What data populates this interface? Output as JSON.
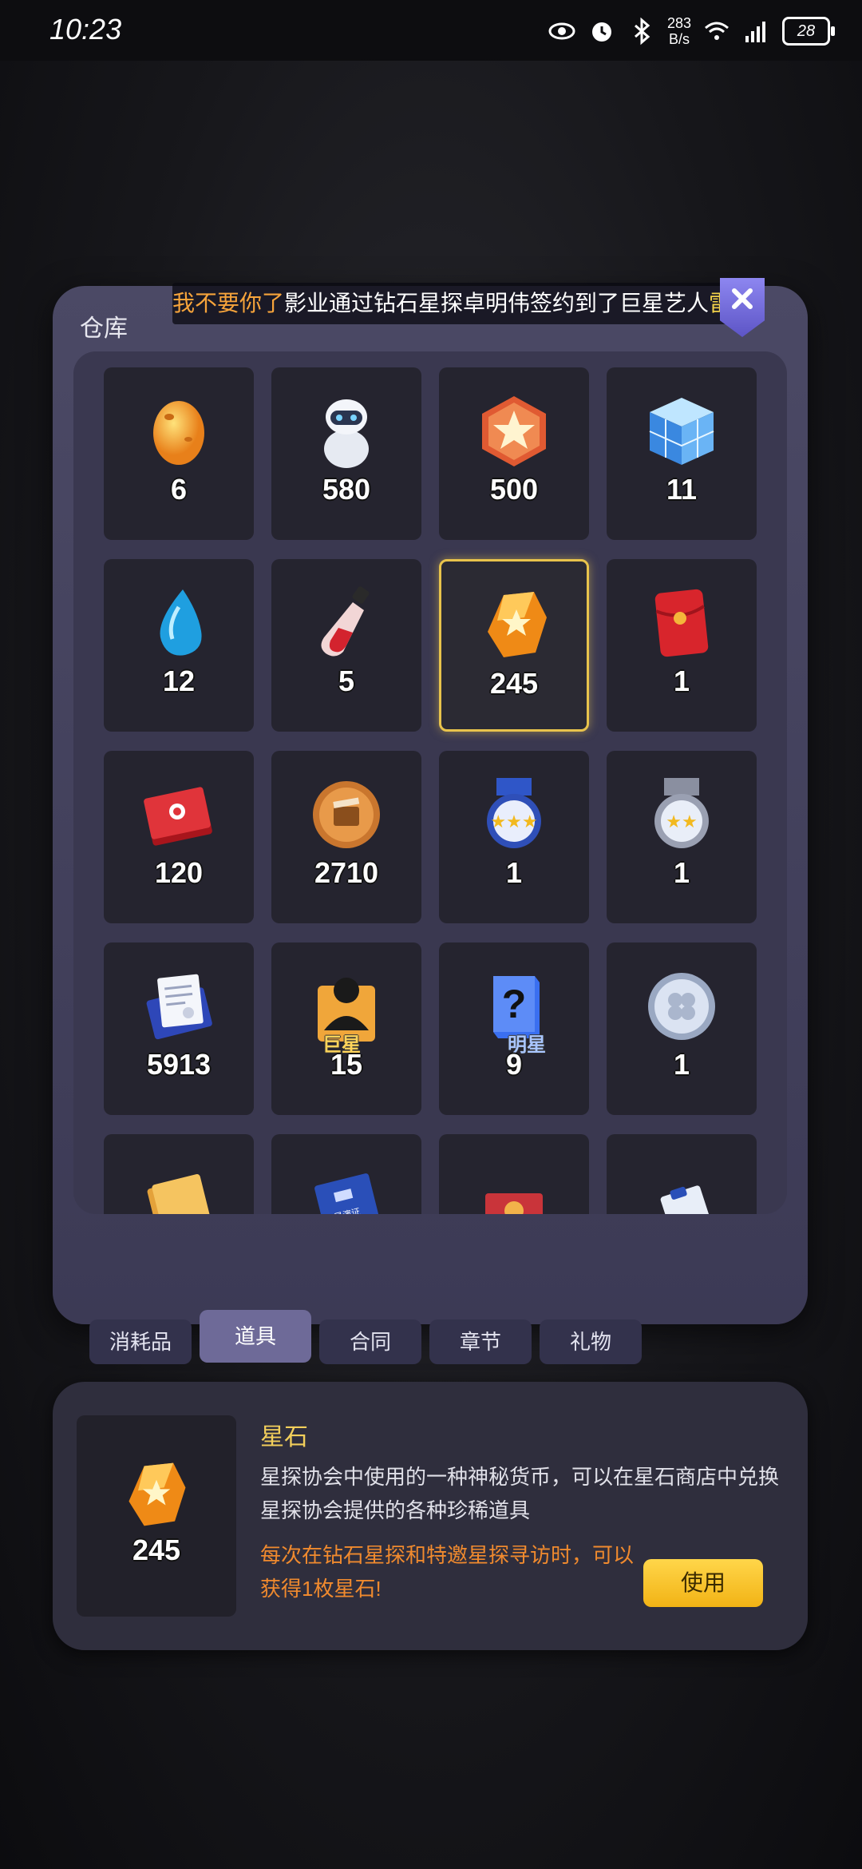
{
  "status_bar": {
    "time": "10:23",
    "net_speed_value": "283",
    "net_speed_unit": "B/s",
    "battery": "28"
  },
  "warehouse": {
    "title": "仓库",
    "ticker": {
      "part1": "我不要你了",
      "part2": "影业通过钻石星探卓明伟签约到了巨星艺人",
      "part3": "雷泽宇"
    },
    "items": [
      {
        "icon": "egg-icon",
        "count": "6"
      },
      {
        "icon": "robot-icon",
        "count": "580"
      },
      {
        "icon": "star-badge-icon",
        "count": "500"
      },
      {
        "icon": "cube-icon",
        "count": "11"
      },
      {
        "icon": "water-drop-icon",
        "count": "12"
      },
      {
        "icon": "potion-icon",
        "count": "5"
      },
      {
        "icon": "star-stone-icon",
        "count": "245"
      },
      {
        "icon": "red-envelope-icon",
        "count": "1"
      },
      {
        "icon": "ticket-icon",
        "count": "120"
      },
      {
        "icon": "film-coin-icon",
        "count": "2710"
      },
      {
        "icon": "gold-medal-icon",
        "count": "1"
      },
      {
        "icon": "silver-medal-icon",
        "count": "1"
      },
      {
        "icon": "contract-icon",
        "count": "5913"
      },
      {
        "icon": "superstar-card-icon",
        "count": "15",
        "label": "巨星"
      },
      {
        "icon": "mystery-box-icon",
        "count": "9",
        "label": "明星"
      },
      {
        "icon": "clover-coin-icon",
        "count": "1"
      },
      {
        "icon": "book-icon",
        "count": ""
      },
      {
        "icon": "director-pass-icon",
        "count": "",
        "label": "导演证"
      },
      {
        "icon": "red-ticket-icon",
        "count": ""
      },
      {
        "icon": "clipboard-icon",
        "count": ""
      }
    ]
  },
  "tabs": [
    {
      "label": "消耗品"
    },
    {
      "label": "道具"
    },
    {
      "label": "合同"
    },
    {
      "label": "章节"
    },
    {
      "label": "礼物"
    }
  ],
  "detail": {
    "count": "245",
    "name": "星石",
    "description": "星探协会中使用的一种神秘货币，可以在星石商店中兑换星探协会提供的各种珍稀道具",
    "tip": "每次在钻石星探和特邀星探寻访时，可以获得1枚星石!",
    "use_label": "使用"
  },
  "colors": {
    "accent_gold": "#f3cf5b",
    "tip_orange": "#f08a2e",
    "selected_border": "#e8c34c",
    "use_button": "#f2b315"
  }
}
